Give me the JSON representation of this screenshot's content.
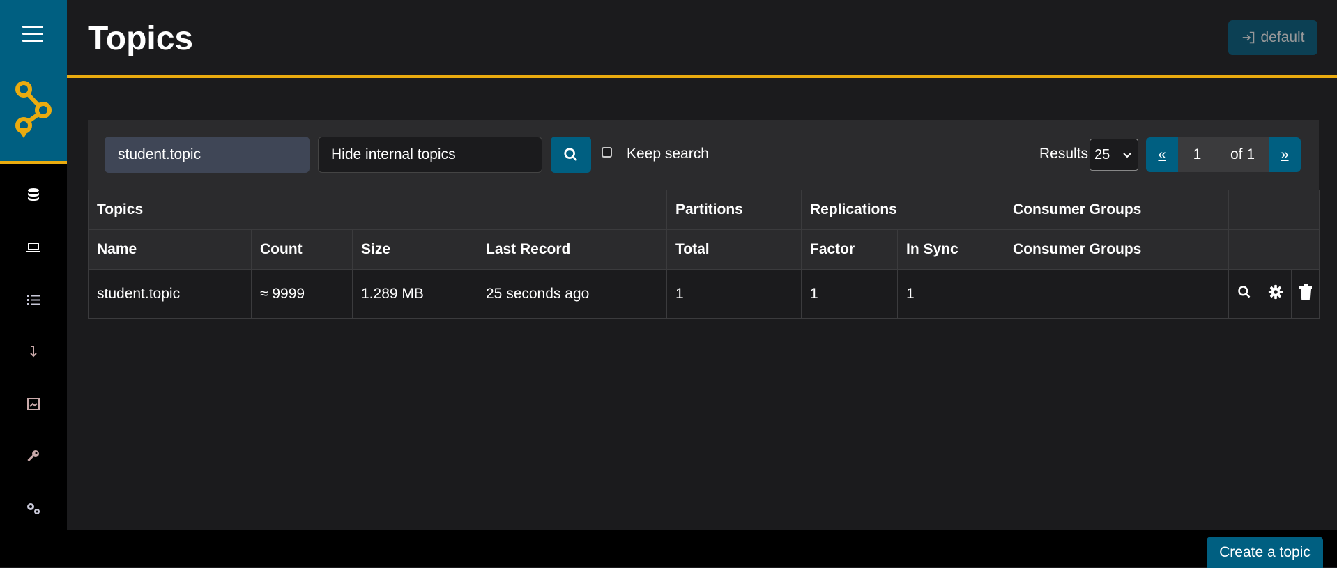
{
  "page": {
    "title": "Topics"
  },
  "header": {
    "cluster_label": "default"
  },
  "search": {
    "value": "student.topic",
    "filter_label": "Hide internal topics",
    "keep_search_label": "Keep search",
    "keep_search_checked": false
  },
  "pagination": {
    "results_label": "Results",
    "page_size": "25",
    "prev": "«",
    "current": "1",
    "of_label": "of 1",
    "next": "»"
  },
  "table": {
    "group_headers": [
      "Topics",
      "Partitions",
      "Replications",
      "Consumer Groups"
    ],
    "columns": [
      "Name",
      "Count",
      "Size",
      "Last Record",
      "Total",
      "Factor",
      "In Sync",
      "Consumer Groups"
    ],
    "rows": [
      {
        "name": "student.topic",
        "count": "≈ 9999",
        "size": "1.289 MB",
        "last_record": "25 seconds ago",
        "total": "1",
        "factor": "1",
        "in_sync": "1",
        "consumer_groups": ""
      }
    ]
  },
  "footer": {
    "create_label": "Create a topic"
  },
  "colors": {
    "accent": "#eaab0f",
    "primary": "#005f81",
    "background": "#1b1b1d",
    "panel": "#2b2b2d"
  }
}
